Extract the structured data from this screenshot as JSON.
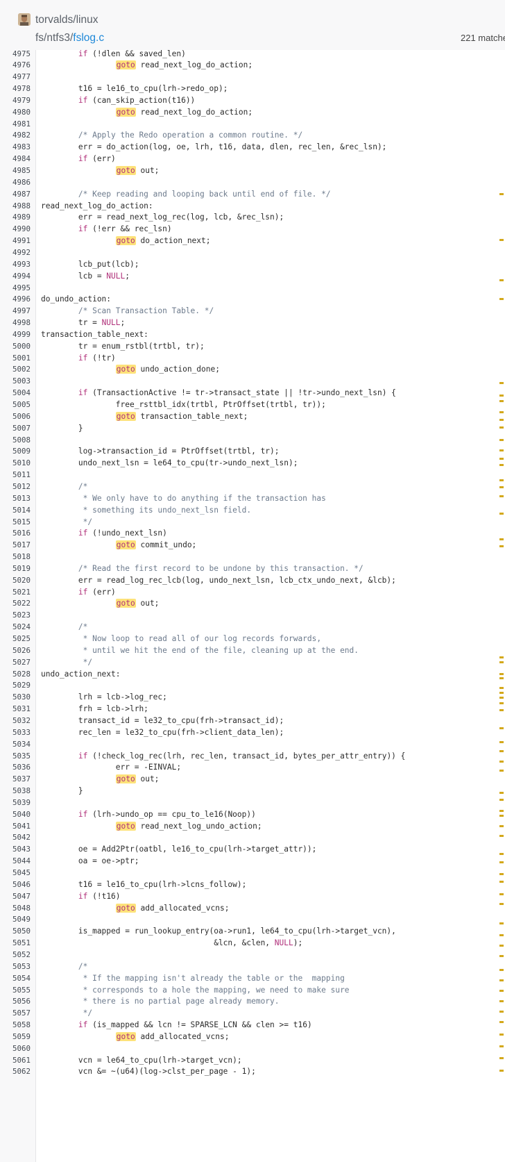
{
  "repo": "torvalds/linux",
  "path": {
    "dir": "fs/ntfs3/",
    "file": "fslog.c"
  },
  "matches_label": "221 matche",
  "colors": {
    "keyword": "#b0307a",
    "comment": "#6c7a8c",
    "highlight": "#fde27a",
    "link": "#1e88d8",
    "scroll_mark": "#d4a91c"
  },
  "code": {
    "lines": [
      {
        "n": "4975",
        "t": "\tif (!dlen && saved_len)"
      },
      {
        "n": "4976",
        "t": "\t\tgoto read_next_log_do_action;"
      },
      {
        "n": "4977",
        "t": ""
      },
      {
        "n": "4978",
        "t": "\tt16 = le16_to_cpu(lrh->redo_op);"
      },
      {
        "n": "4979",
        "t": "\tif (can_skip_action(t16))"
      },
      {
        "n": "4980",
        "t": "\t\tgoto read_next_log_do_action;"
      },
      {
        "n": "4981",
        "t": ""
      },
      {
        "n": "4982",
        "t": "\t/* Apply the Redo operation a common routine. */"
      },
      {
        "n": "4983",
        "t": "\terr = do_action(log, oe, lrh, t16, data, dlen, rec_len, &rec_lsn);"
      },
      {
        "n": "4984",
        "t": "\tif (err)"
      },
      {
        "n": "4985",
        "t": "\t\tgoto out;"
      },
      {
        "n": "4986",
        "t": ""
      },
      {
        "n": "4987",
        "t": "\t/* Keep reading and looping back until end of file. */"
      },
      {
        "n": "4988",
        "t": "read_next_log_do_action:"
      },
      {
        "n": "4989",
        "t": "\terr = read_next_log_rec(log, lcb, &rec_lsn);"
      },
      {
        "n": "4990",
        "t": "\tif (!err && rec_lsn)"
      },
      {
        "n": "4991",
        "t": "\t\tgoto do_action_next;"
      },
      {
        "n": "4992",
        "t": ""
      },
      {
        "n": "4993",
        "t": "\tlcb_put(lcb);"
      },
      {
        "n": "4994",
        "t": "\tlcb = NULL;"
      },
      {
        "n": "4995",
        "t": ""
      },
      {
        "n": "4996",
        "t": "do_undo_action:"
      },
      {
        "n": "4997",
        "t": "\t/* Scan Transaction Table. */"
      },
      {
        "n": "4998",
        "t": "\ttr = NULL;"
      },
      {
        "n": "4999",
        "t": "transaction_table_next:"
      },
      {
        "n": "5000",
        "t": "\ttr = enum_rstbl(trtbl, tr);"
      },
      {
        "n": "5001",
        "t": "\tif (!tr)"
      },
      {
        "n": "5002",
        "t": "\t\tgoto undo_action_done;"
      },
      {
        "n": "5003",
        "t": ""
      },
      {
        "n": "5004",
        "t": "\tif (TransactionActive != tr->transact_state || !tr->undo_next_lsn) {"
      },
      {
        "n": "5005",
        "t": "\t\tfree_rsttbl_idx(trtbl, PtrOffset(trtbl, tr));"
      },
      {
        "n": "5006",
        "t": "\t\tgoto transaction_table_next;"
      },
      {
        "n": "5007",
        "t": "\t}"
      },
      {
        "n": "5008",
        "t": ""
      },
      {
        "n": "5009",
        "t": "\tlog->transaction_id = PtrOffset(trtbl, tr);"
      },
      {
        "n": "5010",
        "t": "\tundo_next_lsn = le64_to_cpu(tr->undo_next_lsn);"
      },
      {
        "n": "5011",
        "t": ""
      },
      {
        "n": "5012",
        "t": "\t/*"
      },
      {
        "n": "5013",
        "t": "\t * We only have to do anything if the transaction has"
      },
      {
        "n": "5014",
        "t": "\t * something its undo_next_lsn field."
      },
      {
        "n": "5015",
        "t": "\t */"
      },
      {
        "n": "5016",
        "t": "\tif (!undo_next_lsn)"
      },
      {
        "n": "5017",
        "t": "\t\tgoto commit_undo;"
      },
      {
        "n": "5018",
        "t": ""
      },
      {
        "n": "5019",
        "t": "\t/* Read the first record to be undone by this transaction. */"
      },
      {
        "n": "5020",
        "t": "\terr = read_log_rec_lcb(log, undo_next_lsn, lcb_ctx_undo_next, &lcb);"
      },
      {
        "n": "5021",
        "t": "\tif (err)"
      },
      {
        "n": "5022",
        "t": "\t\tgoto out;"
      },
      {
        "n": "5023",
        "t": ""
      },
      {
        "n": "5024",
        "t": "\t/*"
      },
      {
        "n": "5025",
        "t": "\t * Now loop to read all of our log records forwards,"
      },
      {
        "n": "5026",
        "t": "\t * until we hit the end of the file, cleaning up at the end."
      },
      {
        "n": "5027",
        "t": "\t */"
      },
      {
        "n": "5028",
        "t": "undo_action_next:"
      },
      {
        "n": "5029",
        "t": ""
      },
      {
        "n": "5030",
        "t": "\tlrh = lcb->log_rec;"
      },
      {
        "n": "5031",
        "t": "\tfrh = lcb->lrh;"
      },
      {
        "n": "5032",
        "t": "\ttransact_id = le32_to_cpu(frh->transact_id);"
      },
      {
        "n": "5033",
        "t": "\trec_len = le32_to_cpu(frh->client_data_len);"
      },
      {
        "n": "5034",
        "t": ""
      },
      {
        "n": "5035",
        "t": "\tif (!check_log_rec(lrh, rec_len, transact_id, bytes_per_attr_entry)) {"
      },
      {
        "n": "5036",
        "t": "\t\terr = -EINVAL;"
      },
      {
        "n": "5037",
        "t": "\t\tgoto out;"
      },
      {
        "n": "5038",
        "t": "\t}"
      },
      {
        "n": "5039",
        "t": ""
      },
      {
        "n": "5040",
        "t": "\tif (lrh->undo_op == cpu_to_le16(Noop))"
      },
      {
        "n": "5041",
        "t": "\t\tgoto read_next_log_undo_action;"
      },
      {
        "n": "5042",
        "t": ""
      },
      {
        "n": "5043",
        "t": "\toe = Add2Ptr(oatbl, le16_to_cpu(lrh->target_attr));"
      },
      {
        "n": "5044",
        "t": "\toa = oe->ptr;"
      },
      {
        "n": "5045",
        "t": ""
      },
      {
        "n": "5046",
        "t": "\tt16 = le16_to_cpu(lrh->lcns_follow);"
      },
      {
        "n": "5047",
        "t": "\tif (!t16)"
      },
      {
        "n": "5048",
        "t": "\t\tgoto add_allocated_vcns;"
      },
      {
        "n": "5049",
        "t": ""
      },
      {
        "n": "5050",
        "t": "\tis_mapped = run_lookup_entry(oa->run1, le64_to_cpu(lrh->target_vcn),"
      },
      {
        "n": "5051",
        "t": "\t\t\t\t     &lcn, &clen, NULL);"
      },
      {
        "n": "5052",
        "t": ""
      },
      {
        "n": "5053",
        "t": "\t/*"
      },
      {
        "n": "5054",
        "t": "\t * If the mapping isn't already the table or the  mapping"
      },
      {
        "n": "5055",
        "t": "\t * corresponds to a hole the mapping, we need to make sure"
      },
      {
        "n": "5056",
        "t": "\t * there is no partial page already memory."
      },
      {
        "n": "5057",
        "t": "\t */"
      },
      {
        "n": "5058",
        "t": "\tif (is_mapped && lcn != SPARSE_LCN && clen >= t16)"
      },
      {
        "n": "5059",
        "t": "\t\tgoto add_allocated_vcns;"
      },
      {
        "n": "5060",
        "t": ""
      },
      {
        "n": "5061",
        "t": "\tvcn = le64_to_cpu(lrh->target_vcn);"
      },
      {
        "n": "5062",
        "t": "\tvcn &= ~(u64)(log->clst_per_page - 1);"
      }
    ]
  }
}
